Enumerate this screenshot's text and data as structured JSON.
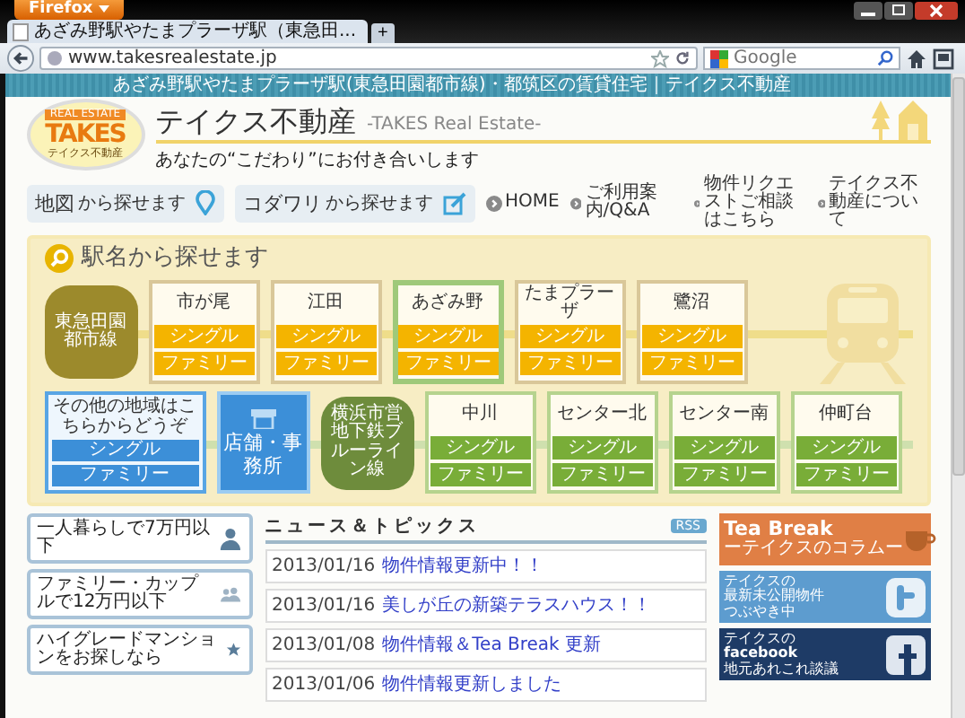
{
  "browser": {
    "menu_button": "Firefox",
    "tab_title": "あざみ野駅やたまプラーザ駅（東急田...",
    "new_tab": "+",
    "url": "www.takesrealestate.jp",
    "search_placeholder": "Google"
  },
  "site": {
    "banner": "あざみ野駅やたまプラーザ駅(東急田園都市線)・都筑区の賃貸住宅｜テイクス不動産",
    "logo": {
      "top": "REAL ESTATE",
      "main": "TAKES",
      "bottom": "テイクス不動産"
    },
    "title": "テイクス不動産",
    "subtitle": "-TAKES Real Estate-",
    "tagline": "あなたの“こだわり”にお付き合いします"
  },
  "nav": {
    "buttons": [
      {
        "main": "地図",
        "sub": "から探せます",
        "kind": "map"
      },
      {
        "main": "コダワリ",
        "sub": "から探せます",
        "kind": "edit"
      }
    ],
    "links": [
      "HOME",
      "ご利用案内/Q&A",
      "物件リクエストご相談はこちら",
      "テイクス不動産について"
    ]
  },
  "stations": {
    "title": "駅名から探せます",
    "lines": [
      {
        "name": "東急田園都市線",
        "kind": "tokyu",
        "stations": [
          {
            "name": "市が尾",
            "selected": false,
            "buttons": [
              "シングル",
              "ファミリー"
            ]
          },
          {
            "name": "江田",
            "selected": false,
            "buttons": [
              "シングル",
              "ファミリー"
            ]
          },
          {
            "name": "あざみ野",
            "selected": true,
            "buttons": [
              "シングル",
              "ファミリー"
            ]
          },
          {
            "name": "たまプラーザ",
            "selected": false,
            "buttons": [
              "シングル",
              "ファミリー"
            ]
          },
          {
            "name": "鷺沼",
            "selected": false,
            "buttons": [
              "シングル",
              "ファミリー"
            ]
          }
        ]
      },
      {
        "name": "横浜市営地下鉄ブルーライン線",
        "kind": "blueline",
        "stations": [
          {
            "name": "中川",
            "selected": false,
            "buttons": [
              "シングル",
              "ファミリー"
            ]
          },
          {
            "name": "センター北",
            "selected": false,
            "buttons": [
              "シングル",
              "ファミリー"
            ]
          },
          {
            "name": "センター南",
            "selected": false,
            "buttons": [
              "シングル",
              "ファミリー"
            ]
          },
          {
            "name": "仲町台",
            "selected": false,
            "buttons": [
              "シングル",
              "ファミリー"
            ]
          }
        ]
      }
    ],
    "other_area": {
      "text": "その他の地域はこちらからどうぞ",
      "buttons": [
        "シングル",
        "ファミリー"
      ]
    },
    "shop": "店舗・事務所"
  },
  "quick_links": [
    {
      "text": "一人暮らしで7万円以下",
      "kind": "single"
    },
    {
      "text": "ファミリー・カップルで12万円以下",
      "kind": "family"
    },
    {
      "text": "ハイグレードマンションをお探しなら",
      "kind": "star"
    }
  ],
  "news": {
    "title": "ニュース＆トピックス",
    "rss": "RSS",
    "items": [
      {
        "date": "2013/01/16",
        "title": "物件情報更新中！！"
      },
      {
        "date": "2013/01/16",
        "title": "美しが丘の新築テラスハウス！！"
      },
      {
        "date": "2013/01/08",
        "title": "物件情報＆Tea Break 更新"
      },
      {
        "date": "2013/01/06",
        "title": "物件情報更新しました"
      }
    ]
  },
  "banners": [
    {
      "kind": "tea",
      "lines": [
        "Tea Break",
        "ーテイクスのコラムー"
      ]
    },
    {
      "kind": "twitter",
      "lines": [
        "テイクスの",
        "最新未公開物件",
        "つぶやき中"
      ]
    },
    {
      "kind": "facebook",
      "lines": [
        "テイクスの",
        "facebook",
        "地元あれこれ談議"
      ]
    }
  ]
}
